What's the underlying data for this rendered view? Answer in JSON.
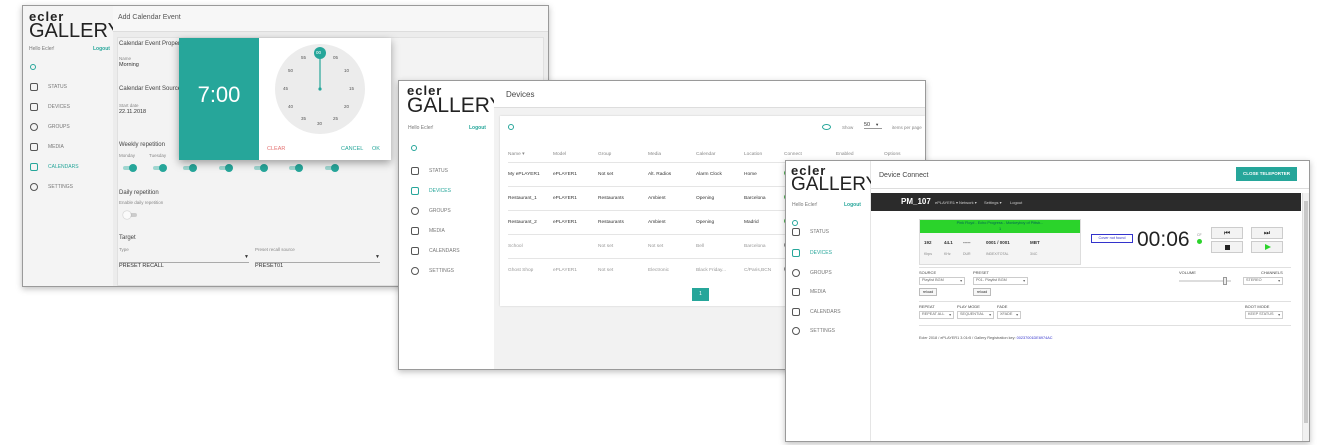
{
  "brand": {
    "ecler": "ecler",
    "gallery": "GALLERY"
  },
  "user": {
    "greeting": "Hello Ecler!",
    "logout": "Logout"
  },
  "nav": [
    {
      "label": "STATUS"
    },
    {
      "label": "DEVICES"
    },
    {
      "label": "GROUPS"
    },
    {
      "label": "MEDIA"
    },
    {
      "label": "CALENDARS"
    },
    {
      "label": "SETTINGS"
    }
  ],
  "win1": {
    "title": "Add Calendar Event",
    "section_props": "Calendar Event Propert",
    "name_label": "Name",
    "name_value": "Morning",
    "section_source": "Calendar Event Source",
    "start_label": "Start date",
    "start_value": "22.11.2018",
    "weekly": "Weekly repetition",
    "days": [
      "Monday",
      "Tuesday"
    ],
    "daily": "Daily repetition",
    "daily_sub": "Enable daily repetition",
    "target": "Target",
    "type_label": "Type",
    "type_value": "PRESET RECALL",
    "preset_label": "Preset recall source",
    "preset_value": "PRESET01",
    "edge_label": "Fix",
    "picker": {
      "time": "7:00",
      "clear": "CLEAR",
      "cancel": "CANCEL",
      "ok": "OK",
      "minutes": [
        "00",
        "05",
        "10",
        "15",
        "20",
        "25",
        "30",
        "35",
        "40",
        "45",
        "50",
        "55"
      ]
    }
  },
  "win2": {
    "title": "Devices",
    "show_label": "Show",
    "show_value": "50",
    "per_page": "items per page",
    "columns": [
      "Name ▾",
      "Model",
      "Group",
      "Media",
      "Calendar",
      "Location",
      "Connect",
      "Enabled",
      "Options"
    ],
    "rows": [
      [
        "My ePLAYER1",
        "ePLAYER1",
        "Not set",
        "Alt. Radios",
        "Alarm Clock",
        "Home"
      ],
      [
        "Restaurant_1",
        "ePLAYER1",
        "Restaurants",
        "Ambient",
        "Opening",
        "Barcelona"
      ],
      [
        "Restaurant_2",
        "ePLAYER1",
        "Restaurants",
        "Ambient",
        "Opening",
        "Madrid"
      ],
      [
        "School",
        "",
        "Not set",
        "Not set",
        "Bell",
        "Barcelona"
      ],
      [
        "Ghost Shop",
        "ePLAYER1",
        "Not set",
        "Electronic",
        "Black Friday...",
        "C/Paris,BCN"
      ]
    ],
    "page": "1"
  },
  "win3": {
    "title": "Device Connect",
    "close_btn": "CLOSE TELEPORTER",
    "device": "PM_107",
    "menu": [
      "ePLAYER1 ▾",
      "Network ▾",
      "Settings ▾",
      "Logout"
    ],
    "green_text": "Pink Floyd - Echo Progress - Monkeyboy of Pittsb...",
    "green_text2": "1",
    "stats": [
      "192",
      "44.1",
      "-----",
      "0001 / 0001",
      "MBT"
    ],
    "stats_sub": [
      "Kbps",
      "KHz",
      "DUR",
      "INDEX/TOTAL",
      "3/4C"
    ],
    "cover": "Cover not found",
    "elapsed": "00:06",
    "cf_label": "CF",
    "source_label": "SOURCE",
    "source_value": "Playlist BGM",
    "preset_label": "PRESET",
    "preset_value": "P01- Playlist BGM",
    "reload": "reload",
    "volume_label": "VOLUME",
    "channels_label": "CHANNELS",
    "channels_value": "STEREO",
    "repeat_label": "REPEAT",
    "repeat_value": "REPEAT ALL",
    "playmode_label": "PLAY MODE",
    "playmode_value": "SEQUENTIAL",
    "fade_label": "FADE",
    "fade_value": "XFADE",
    "boot_label": "BOOT MODE",
    "boot_value": "KEEP STATUS",
    "footer": "Ecler 2018 / ePLAYER1 3.01r5 / Gallery Registration key:",
    "footer_key": "00237001DE6974AC"
  },
  "colors": {
    "accent": "#26a69a",
    "green": "#2bd32b",
    "dark": "#2b2b2b"
  }
}
